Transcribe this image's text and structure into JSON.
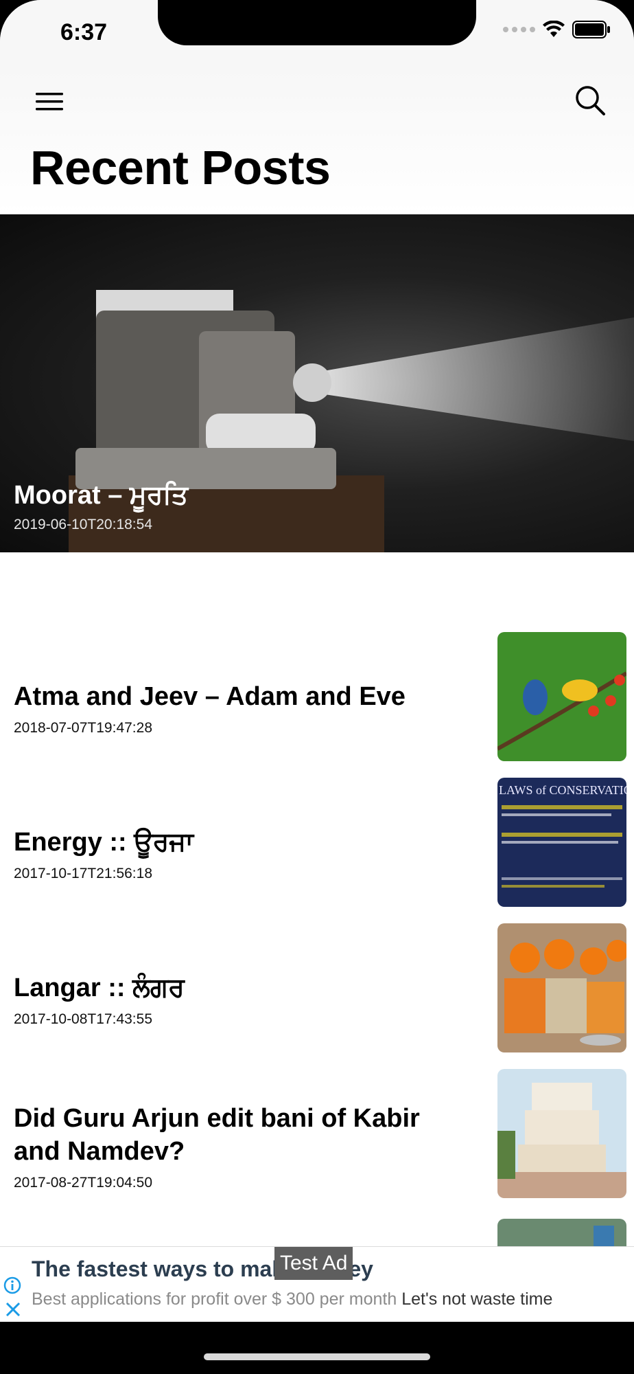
{
  "status_bar": {
    "time": "6:37"
  },
  "header": {
    "title": "Recent Posts"
  },
  "featured_post": {
    "title": "Moorat – ਮੂਰਤਿ",
    "date": "2019-06-10T20:18:54"
  },
  "posts": [
    {
      "title": "Atma and Jeev – Adam and Eve",
      "date": "2018-07-07T19:47:28"
    },
    {
      "title": "Energy :: ਊਰਜਾ",
      "date": "2017-10-17T21:56:18"
    },
    {
      "title": "Langar :: ਲੰਗਰ",
      "date": "2017-10-08T17:43:55"
    },
    {
      "title": "Did Guru Arjun edit bani of Kabir and Namdev?",
      "date": "2017-08-27T19:04:50"
    }
  ],
  "thumb_text": {
    "energy_heading": "LAWS of CONSERVATIO"
  },
  "ad": {
    "label": "Test Ad",
    "headline": "The fastest ways to make money",
    "body": "Best applications for profit over $ 300 per month",
    "cta": "Let's not waste time"
  },
  "colors": {
    "background": "#ffffff",
    "nav_background": "#f7f7f7",
    "ad_info_blue": "#1a9be6"
  },
  "icons": [
    "hamburger-menu-icon",
    "search-icon",
    "wifi-icon",
    "battery-icon",
    "cellular-signal-icon",
    "info-icon",
    "close-icon"
  ]
}
